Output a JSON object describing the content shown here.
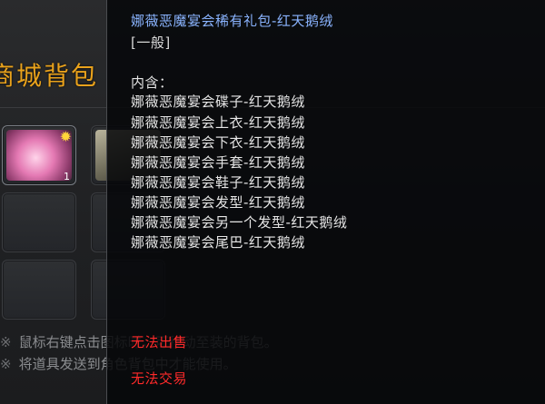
{
  "background": {
    "window_title": "商城背包",
    "notes": [
      {
        "mark": "※",
        "text": "鼠标右键点击图标时，可移动至装的背包。"
      },
      {
        "mark": "※",
        "text": "将道具发送到角色背包中才能使用。"
      }
    ],
    "slots": [
      {
        "row": 0,
        "col": 0,
        "item": "gift-package-icon",
        "count": "1",
        "active": true
      },
      {
        "row": 0,
        "col": 1,
        "item": "item-icon",
        "count": "",
        "active": false
      }
    ]
  },
  "tooltip": {
    "title": "娜薇恶魔宴会稀有礼包-红天鹅绒",
    "grade": "[一般]",
    "contains_label": "内含：",
    "contents": [
      "娜薇恶魔宴会碟子-红天鹅绒",
      "娜薇恶魔宴会上衣-红天鹅绒",
      "娜薇恶魔宴会下衣-红天鹅绒",
      "娜薇恶魔宴会手套-红天鹅绒",
      "娜薇恶魔宴会鞋子-红天鹅绒",
      "娜薇恶魔宴会发型-红天鹅绒",
      "娜薇恶魔宴会另一个发型-红天鹅绒",
      "娜薇恶魔宴会尾巴-红天鹅绒"
    ],
    "restriction_sell": "无法出售",
    "restriction_trade": "无法交易",
    "colors": {
      "title": "#8ab4ff",
      "body": "#e6e6e6",
      "restriction": "#ff2a2a"
    }
  }
}
